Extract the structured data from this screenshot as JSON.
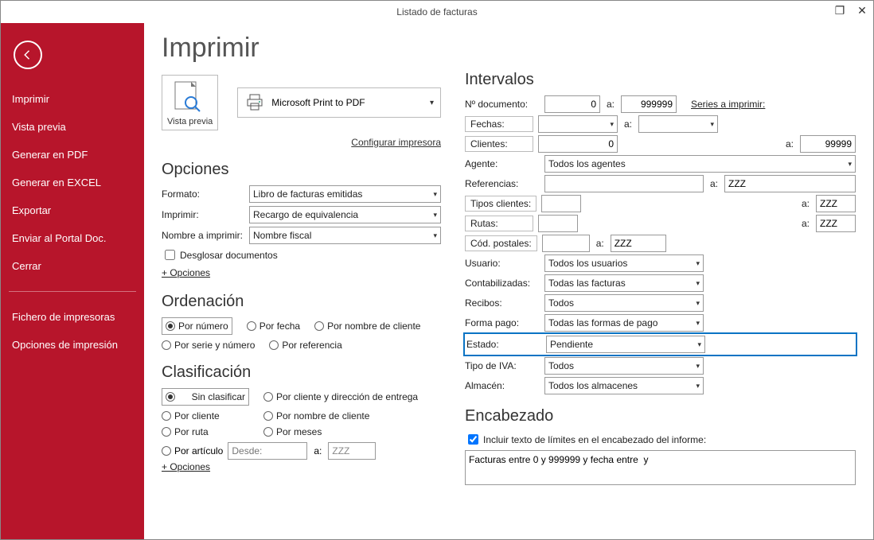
{
  "window": {
    "title": "Listado de facturas"
  },
  "sidebar": {
    "items": [
      "Imprimir",
      "Vista previa",
      "Generar en PDF",
      "Generar en EXCEL",
      "Exportar",
      "Enviar al Portal Doc.",
      "Cerrar"
    ],
    "bottom": [
      "Fichero de impresoras",
      "Opciones de impresión"
    ]
  },
  "page": {
    "title": "Imprimir",
    "preview_label": "Vista previa",
    "printer": "Microsoft Print to PDF",
    "configure_printer": "Configurar impresora"
  },
  "opciones": {
    "title": "Opciones",
    "formato_label": "Formato:",
    "formato_value": "Libro de facturas emitidas",
    "imprimir_label": "Imprimir:",
    "imprimir_value": "Recargo de equivalencia",
    "nombre_label": "Nombre a imprimir:",
    "nombre_value": "Nombre fiscal",
    "desglosar": "Desglosar documentos",
    "plus": "+ Opciones"
  },
  "ordenacion": {
    "title": "Ordenación",
    "options": [
      "Por número",
      "Por fecha",
      "Por nombre de cliente",
      "Por serie y número",
      "Por referencia"
    ],
    "selected": 0
  },
  "clasificacion": {
    "title": "Clasificación",
    "options": [
      "Sin clasificar",
      "Por cliente y dirección de entrega",
      "Por cliente",
      "Por nombre de cliente",
      "Por ruta",
      "Por meses",
      "Por artículo"
    ],
    "selected": 0,
    "desde_label": "Desde:",
    "a_label": "a:",
    "a_value": "ZZZ",
    "plus": "+ Opciones"
  },
  "intervalos": {
    "title": "Intervalos",
    "ndoc_label": "Nº documento:",
    "ndoc_from": "0",
    "a_label": "a:",
    "ndoc_to": "999999",
    "series_link": "Series a imprimir:",
    "fechas_label": "Fechas:",
    "clientes_label": "Clientes:",
    "clientes_from": "0",
    "clientes_to": "99999",
    "agente_label": "Agente:",
    "agente_value": "Todos los agentes",
    "ref_label": "Referencias:",
    "ref_to": "ZZZ",
    "tipos_label": "Tipos clientes:",
    "tipos_to": "ZZZ",
    "rutas_label": "Rutas:",
    "rutas_to": "ZZZ",
    "cp_label": "Cód. postales:",
    "cp_to": "ZZZ",
    "usuario_label": "Usuario:",
    "usuario_value": "Todos los usuarios",
    "contab_label": "Contabilizadas:",
    "contab_value": "Todas las facturas",
    "recibos_label": "Recibos:",
    "recibos_value": "Todos",
    "formapago_label": "Forma pago:",
    "formapago_value": "Todas las formas de pago",
    "estado_label": "Estado:",
    "estado_value": "Pendiente",
    "tipoiva_label": "Tipo de IVA:",
    "tipoiva_value": "Todos",
    "almacen_label": "Almacén:",
    "almacen_value": "Todos los almacenes"
  },
  "encabezado": {
    "title": "Encabezado",
    "checkbox": "Incluir texto de límites en el encabezado del informe:",
    "text": "Facturas entre 0 y 999999 y fecha entre  y"
  }
}
